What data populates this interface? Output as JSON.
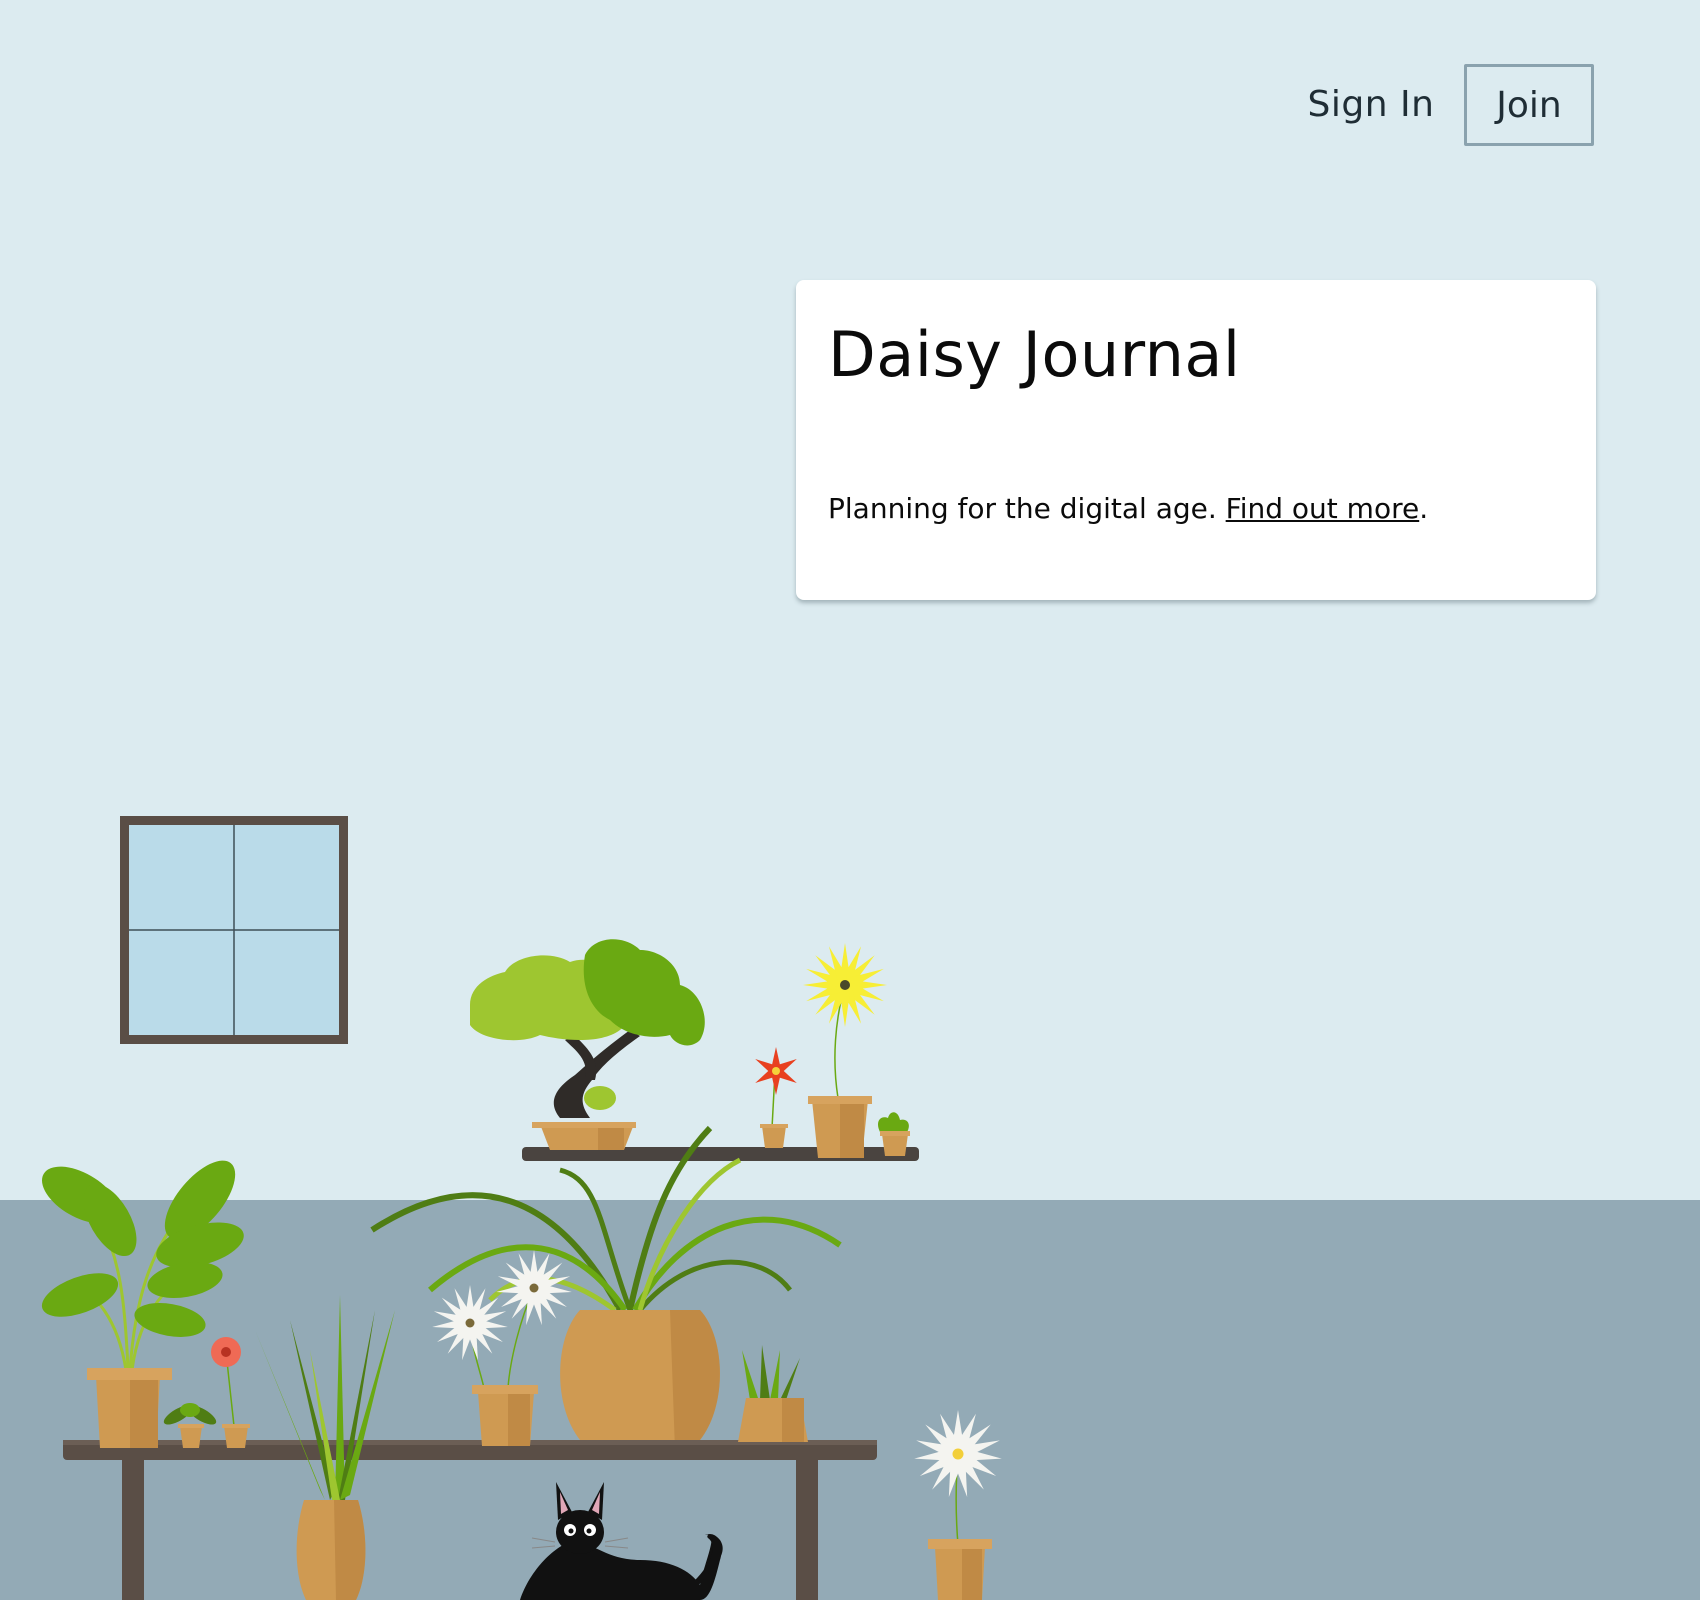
{
  "nav": {
    "sign_in": "Sign In",
    "join": "Join"
  },
  "hero": {
    "title": "Daisy Journal",
    "tagline": "Planning for the digital age.",
    "link": "Find out more",
    "trailing": "."
  },
  "colors": {
    "wall": "#dcebf0",
    "floor": "#93aab6",
    "pot": "#cf9a52",
    "wood": "#5a4e46",
    "leaf_light": "#9ec630",
    "leaf_dark": "#6aa912",
    "window_glass": "#badbe9"
  },
  "illustration": {
    "icons": [
      "window-icon",
      "bonsai-icon",
      "flower-icon",
      "cat-icon",
      "potted-plant-icon",
      "shelf-icon",
      "table-icon"
    ]
  }
}
